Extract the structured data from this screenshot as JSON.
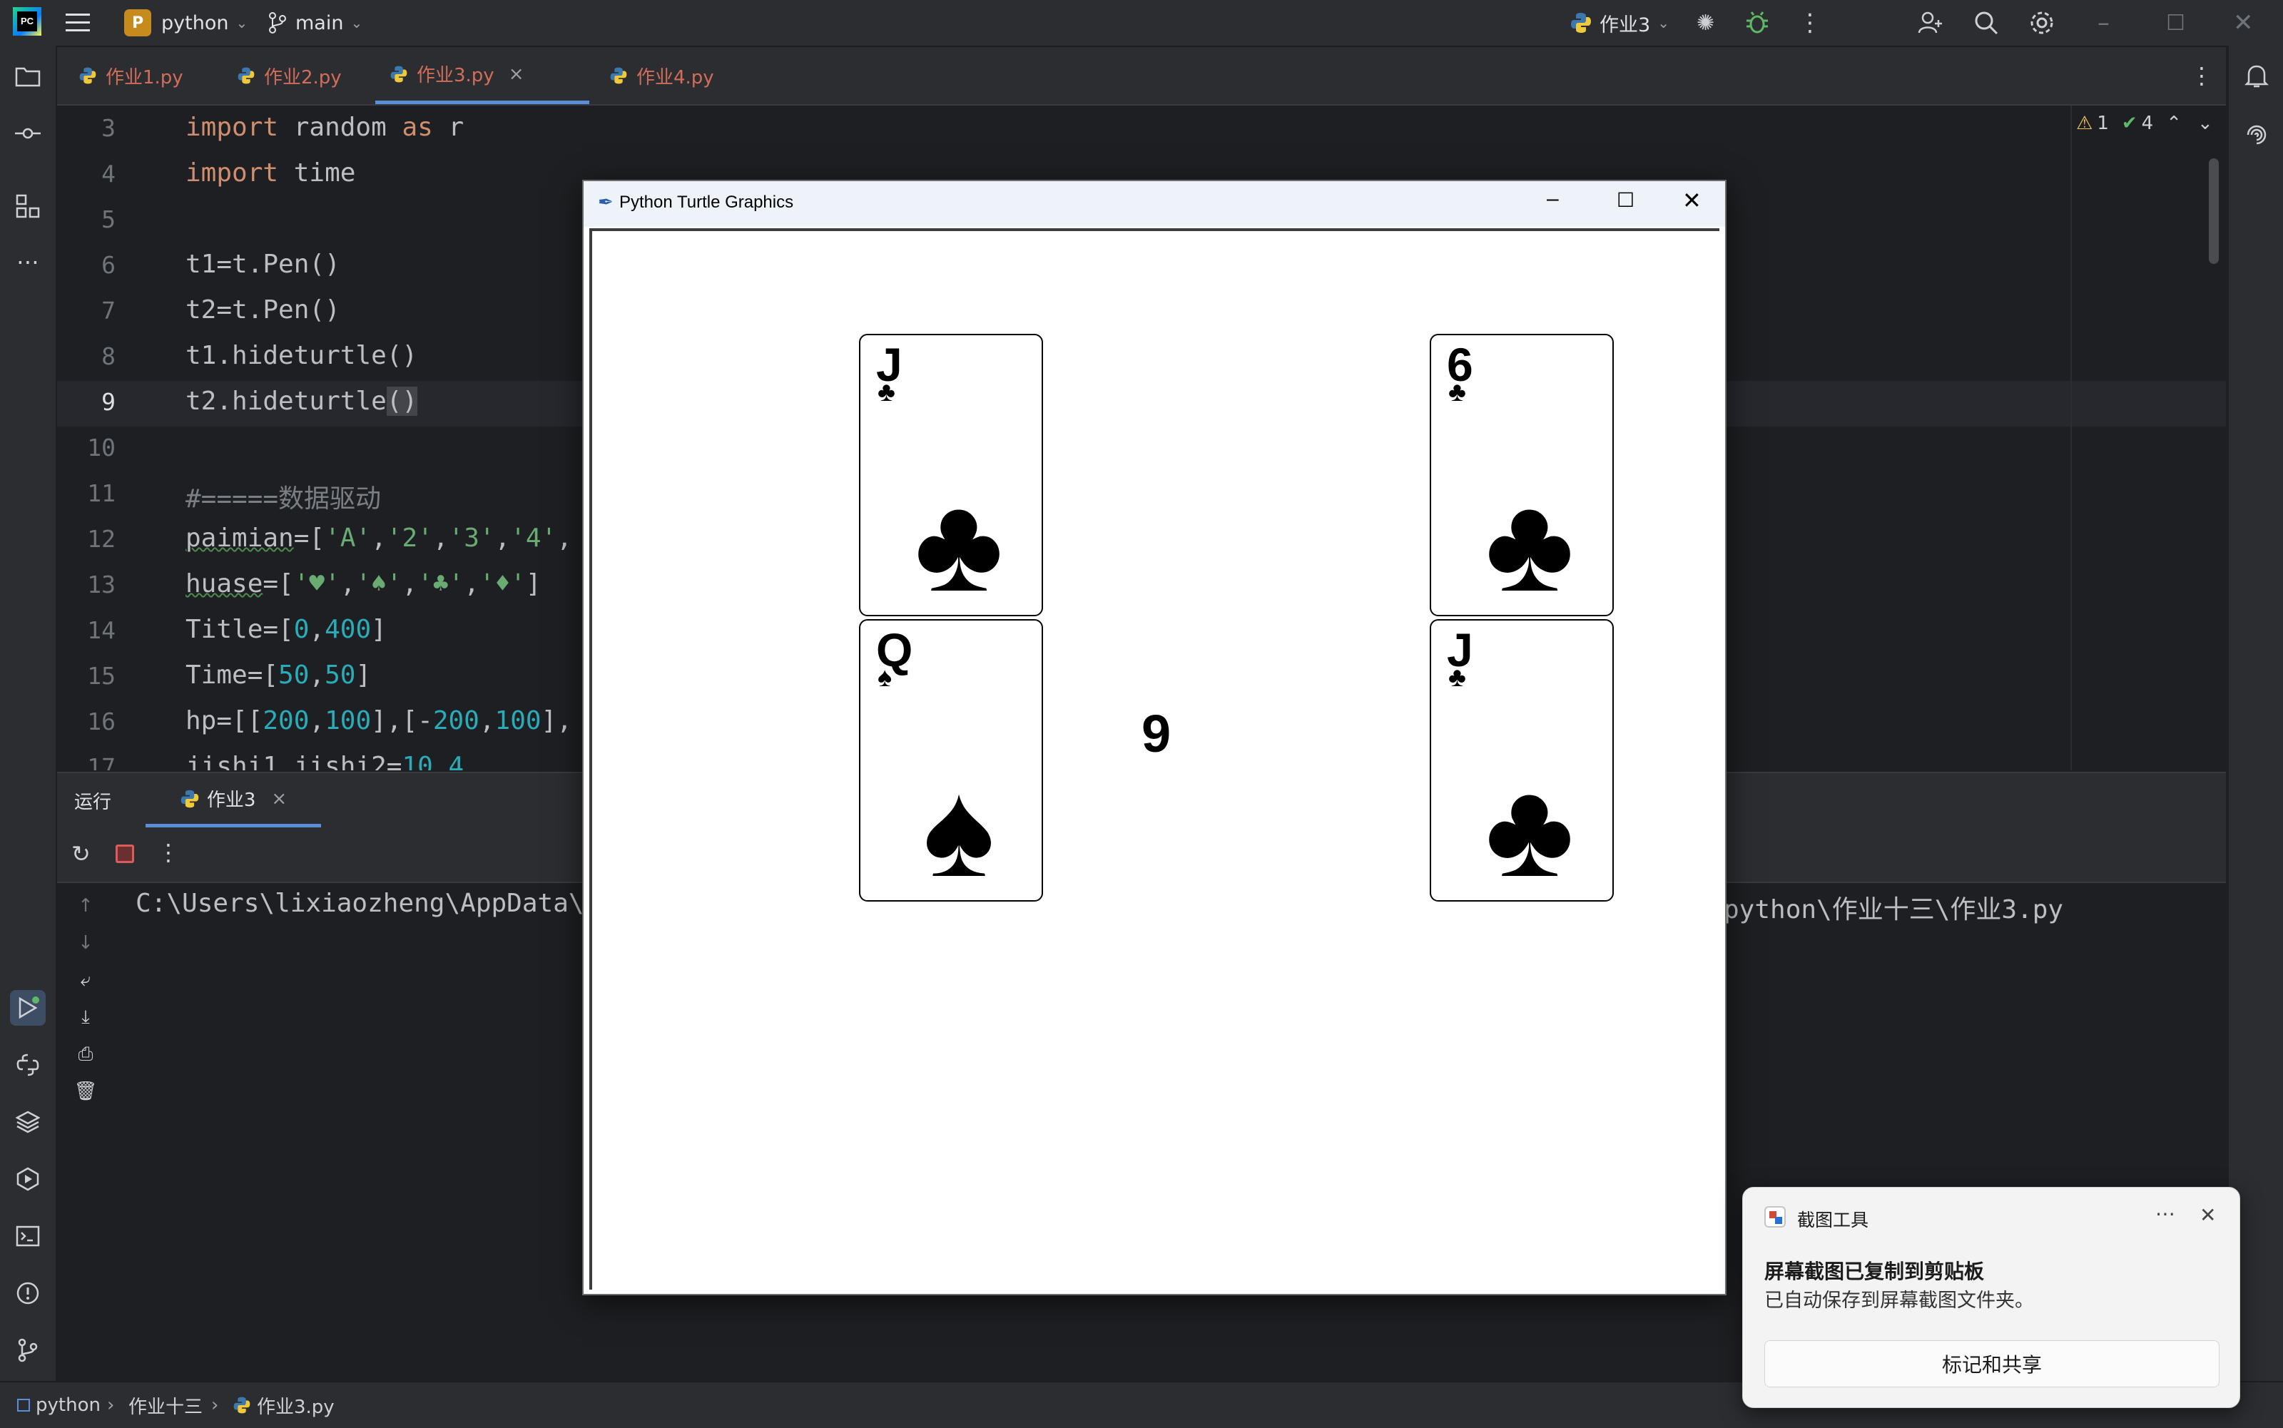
{
  "titlebar": {
    "app_logo": "PC",
    "project_initial": "P",
    "project_name": "python",
    "branch_name": "main",
    "run_config": "作业3",
    "icons": [
      "menu-icon",
      "branch-icon",
      "python-icon",
      "sync-icon",
      "debug-icon",
      "more-icon",
      "add-user-icon",
      "search-icon",
      "settings-icon",
      "minimize-icon",
      "maximize-icon",
      "close-icon"
    ]
  },
  "tabs": [
    {
      "label": "作业1.py",
      "active": false
    },
    {
      "label": "作业2.py",
      "active": false
    },
    {
      "label": "作业3.py",
      "active": true
    },
    {
      "label": "作业4.py",
      "active": false
    }
  ],
  "inspections": {
    "warnings": "1",
    "ok": "4"
  },
  "editor": {
    "line_numbers": [
      "3",
      "4",
      "5",
      "6",
      "7",
      "8",
      "9",
      "10",
      "11",
      "12",
      "13",
      "14",
      "15",
      "16",
      "17"
    ],
    "current_line": "9"
  },
  "run_panel": {
    "title": "运行",
    "tab_label": "作业3",
    "console_left": "C:\\Users\\lixiaozheng\\AppData\\",
    "console_right": "python\\作业十三\\作业3.py"
  },
  "statusbar": {
    "crumbs": [
      "python",
      "作业十三",
      "作业3.py"
    ]
  },
  "turtle_window": {
    "title": "Python Turtle Graphics",
    "center_number": "9",
    "cards": [
      {
        "rank": "J",
        "suit": "♣"
      },
      {
        "rank": "Q",
        "suit": "♠"
      },
      {
        "rank": "6",
        "suit": "♣"
      },
      {
        "rank": "J",
        "suit": "♣"
      }
    ]
  },
  "notification": {
    "app_name": "截图工具",
    "title": "屏幕截图已复制到剪贴板",
    "body": "已自动保存到屏幕截图文件夹。",
    "action": "标记和共享"
  },
  "colors": {
    "keyword": "#cf8e6d",
    "string": "#6aab73",
    "number": "#2aacb8",
    "comment": "#7a7e85",
    "accent": "#5a8fd8"
  }
}
